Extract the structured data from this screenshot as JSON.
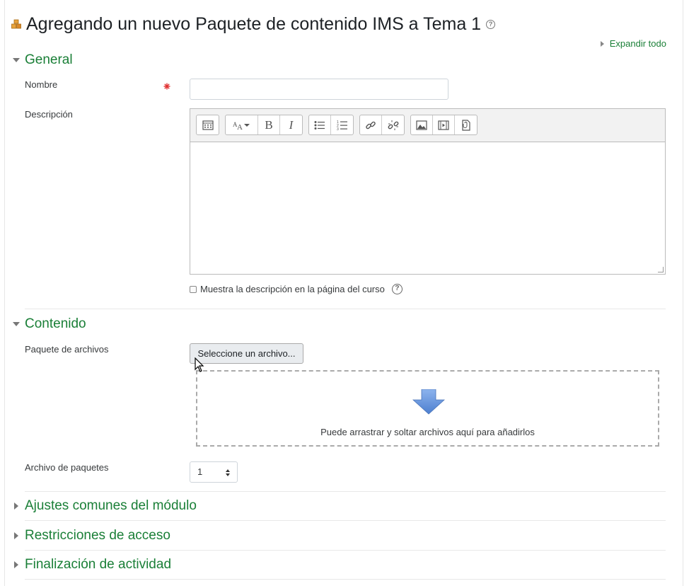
{
  "header": {
    "title": "Agregando un nuevo Paquete de contenido IMS a Tema 1",
    "module_icon": "ims-package-icon",
    "help_icon": "help-icon"
  },
  "expand_all": "Expandir todo",
  "sections": {
    "general": "General",
    "contenido": "Contenido",
    "ajustes": "Ajustes comunes del módulo",
    "restricciones": "Restricciones de acceso",
    "finalizacion": "Finalización de actividad"
  },
  "fields": {
    "nombre_label": "Nombre",
    "nombre_value": "",
    "required_icon": "*",
    "descripcion_label": "Descripción",
    "show_description": "Muestra la descripción en la página del curso",
    "paquete_label": "Paquete de archivos",
    "file_button": "Seleccione un archivo...",
    "drop_text": "Puede arrastrar y soltar archivos aquí para añadirlos",
    "archivo_paquetes_label": "Archivo de paquetes",
    "archivo_paquetes_value": "1"
  },
  "toolbar_icons": [
    "toolbar-toggle-icon",
    "text-style-icon",
    "bold-icon",
    "italic-icon",
    "unordered-list-icon",
    "ordered-list-icon",
    "link-icon",
    "unlink-icon",
    "image-icon",
    "media-icon",
    "file-manage-icon"
  ],
  "colors": {
    "section_heading": "#1a7f37",
    "drop_arrow": "#5b8fd6"
  }
}
